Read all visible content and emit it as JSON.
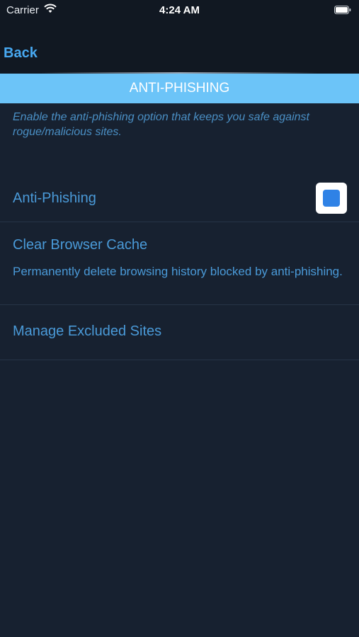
{
  "status_bar": {
    "carrier": "Carrier",
    "time": "4:24 AM",
    "icons": [
      "wifi-icon",
      "battery-icon"
    ]
  },
  "nav": {
    "back_label": "Back",
    "back_color": "#48a9f2"
  },
  "section": {
    "title": "ANTI-PHISHING",
    "description": "Enable the anti-phishing option that keeps you safe against rogue/malicious sites.",
    "header_color": "#6cc4f8"
  },
  "rows": {
    "anti_phishing": {
      "label": "Anti-Phishing",
      "toggle_on": true
    },
    "clear_cache": {
      "label": "Clear Browser Cache",
      "subtitle": "Permanently delete browsing history blocked by anti-phishing."
    },
    "manage_excluded": {
      "label": "Manage Excluded Sites"
    }
  },
  "colors": {
    "background": "#172130",
    "bar_background": "#111822",
    "text_accent": "#4a9ad8"
  }
}
